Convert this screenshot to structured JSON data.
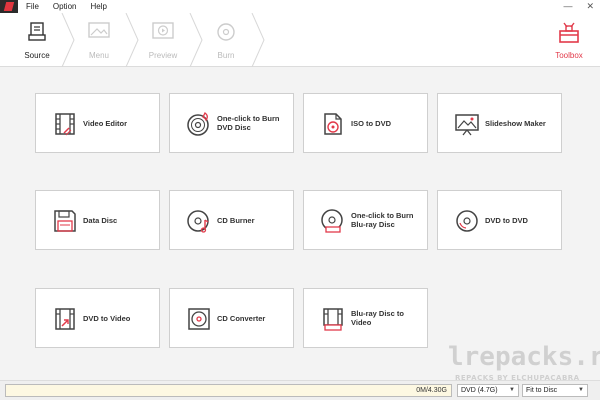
{
  "menu": {
    "items": [
      "File",
      "Option",
      "Help"
    ]
  },
  "window": {
    "minimize": "—",
    "close": "✕"
  },
  "steps": [
    {
      "label": "Source",
      "active": true
    },
    {
      "label": "Menu",
      "active": false
    },
    {
      "label": "Preview",
      "active": false
    },
    {
      "label": "Burn",
      "active": false
    }
  ],
  "toolbox": {
    "label": "Toolbox"
  },
  "tools": [
    {
      "label": "Video Editor",
      "icon": "video-editor-icon"
    },
    {
      "label": "One-click to Burn DVD Disc",
      "icon": "burn-dvd-icon"
    },
    {
      "label": "ISO to DVD",
      "icon": "iso-icon"
    },
    {
      "label": "Slideshow Maker",
      "icon": "slideshow-icon"
    },
    {
      "label": "Data Disc",
      "icon": "floppy-icon"
    },
    {
      "label": "CD Burner",
      "icon": "cd-burner-icon"
    },
    {
      "label": "One-click to Burn Blu-ray Disc",
      "icon": "burn-bluray-icon"
    },
    {
      "label": "DVD to DVD",
      "icon": "dvd-copy-icon"
    },
    {
      "label": "DVD to Video",
      "icon": "dvd-to-video-icon"
    },
    {
      "label": "CD Converter",
      "icon": "cd-converter-icon"
    },
    {
      "label": "Blu-ray Disc to Video",
      "icon": "bluray-to-video-icon"
    }
  ],
  "watermark": {
    "main": "lrepacks.ru",
    "sub": "REPACKS BY ELCHUPACABRA"
  },
  "status": {
    "usage": "0M/4.30G",
    "usage_fraction": 0,
    "disc_type": "DVD (4.7G)",
    "fit_mode": "Fit to Disc"
  },
  "colors": {
    "accent": "#e23a4a",
    "icon_stroke": "#444444"
  }
}
